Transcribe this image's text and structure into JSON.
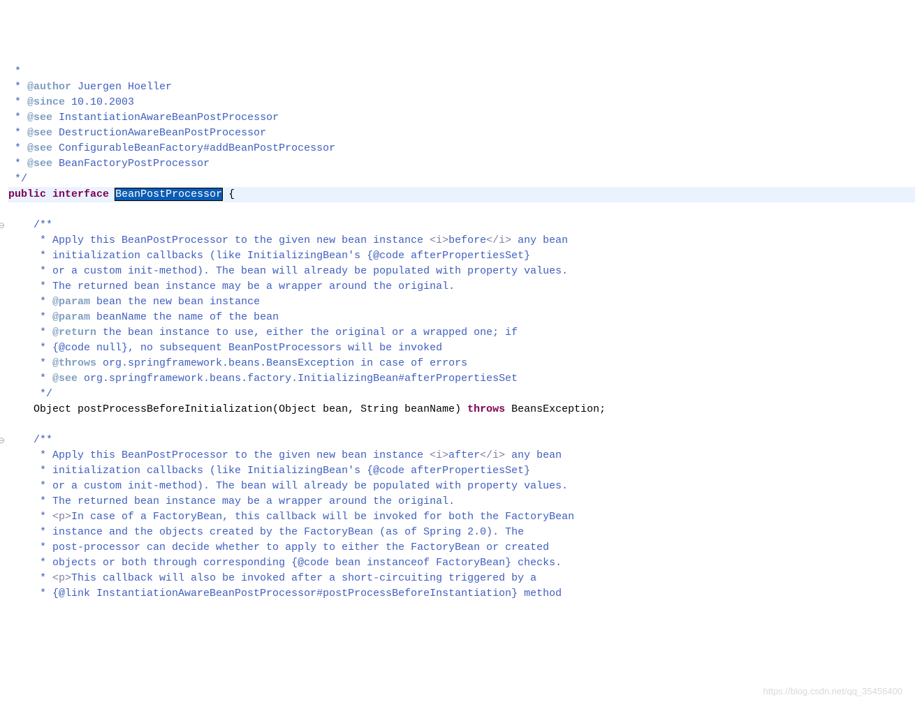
{
  "lines": {
    "l1": " *",
    "l2_pre": " * ",
    "l2_tag": "@author",
    "l2_rest": " Juergen Hoeller",
    "l3_pre": " * ",
    "l3_tag": "@since",
    "l3_rest": " 10.10.2003",
    "l4_pre": " * ",
    "l4_tag": "@see",
    "l4_rest": " InstantiationAwareBeanPostProcessor",
    "l5_pre": " * ",
    "l5_tag": "@see",
    "l5_rest": " DestructionAwareBeanPostProcessor",
    "l6_pre": " * ",
    "l6_tag": "@see",
    "l6_rest": " ConfigurableBeanFactory#addBeanPostProcessor",
    "l7_pre": " * ",
    "l7_tag": "@see",
    "l7_rest": " BeanFactoryPostProcessor",
    "l8": " */",
    "l9_public": "public",
    "l9_interface": "interface",
    "l9_name": "BeanPostProcessor",
    "l9_brace": " {",
    "l10": "",
    "l11": "    /**",
    "l12_a": "     * Apply this BeanPostProcessor to the given new bean instance ",
    "l12_tag1": "<i>",
    "l12_b": "before",
    "l12_tag2": "</i>",
    "l12_c": " any bean",
    "l13": "     * initialization callbacks (like InitializingBean's {@code afterPropertiesSet}",
    "l14": "     * or a custom init-method). The bean will already be populated with property values.",
    "l15": "     * The returned bean instance may be a wrapper around the original.",
    "l16_pre": "     * ",
    "l16_tag": "@param",
    "l16_name": " bean",
    "l16_rest": " the new bean instance",
    "l17_pre": "     * ",
    "l17_tag": "@param",
    "l17_name": " beanName",
    "l17_rest": " the name of the bean",
    "l18_pre": "     * ",
    "l18_tag": "@return",
    "l18_rest": " the bean instance to use, either the original or a wrapped one; if",
    "l19": "     * {@code null}, no subsequent BeanPostProcessors will be invoked",
    "l20_pre": "     * ",
    "l20_tag": "@throws",
    "l20_rest": " org.springframework.beans.BeansException in case of errors",
    "l21_pre": "     * ",
    "l21_tag": "@see",
    "l21_rest": " org.springframework.beans.factory.InitializingBean#afterPropertiesSet",
    "l22": "     */",
    "l23_a": "    Object postProcessBeforeInitialization(Object bean, String beanName) ",
    "l23_throws": "throws",
    "l23_b": " BeansException;",
    "l24": "",
    "l25": "    /**",
    "l26_a": "     * Apply this BeanPostProcessor to the given new bean instance ",
    "l26_tag1": "<i>",
    "l26_b": "after",
    "l26_tag2": "</i>",
    "l26_c": " any bean",
    "l27": "     * initialization callbacks (like InitializingBean's {@code afterPropertiesSet}",
    "l28": "     * or a custom init-method). The bean will already be populated with property values.",
    "l29": "     * The returned bean instance may be a wrapper around the original.",
    "l30_a": "     * ",
    "l30_tag": "<p>",
    "l30_b": "In case of a FactoryBean, this callback will be invoked for both the FactoryBean",
    "l31": "     * instance and the objects created by the FactoryBean (as of Spring 2.0). The",
    "l32": "     * post-processor can decide whether to apply to either the FactoryBean or created",
    "l33": "     * objects or both through corresponding {@code bean instanceof FactoryBean} checks.",
    "l34_a": "     * ",
    "l34_tag": "<p>",
    "l34_b": "This callback will also be invoked after a short-circuiting triggered by a",
    "l35": "     * {@link InstantiationAwareBeanPostProcessor#postProcessBeforeInstantiation} method"
  },
  "fold_markers": {
    "m1": "⊖",
    "m2": "⊖"
  },
  "watermark": "https://blog.csdn.net/qq_35456400"
}
